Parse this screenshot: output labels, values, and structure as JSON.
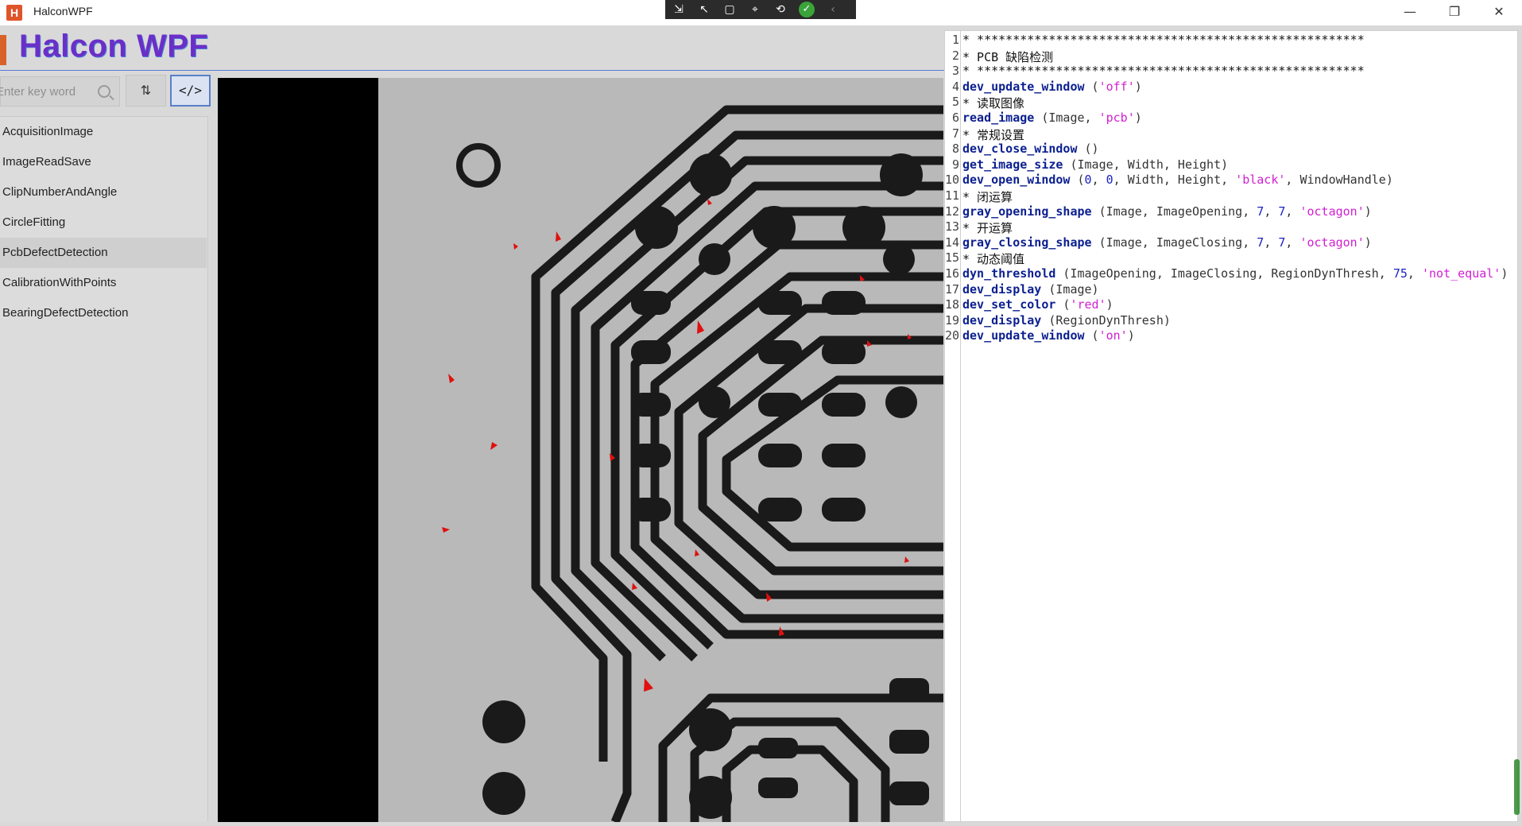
{
  "window": {
    "icon_letter": "H",
    "title": "HalconWPF",
    "minimize_glyph": "—",
    "restore_glyph": "❐",
    "close_glyph": "✕"
  },
  "debug_toolbar": {
    "icons": [
      "step-icon",
      "select-icon",
      "frame-icon",
      "inspect-icon",
      "hot-reload-icon",
      "check-icon",
      "collapse-icon"
    ],
    "glyphs": [
      "⇲",
      "↖",
      "▢",
      "⌖",
      "⟲",
      "✓",
      "‹"
    ]
  },
  "header": {
    "title": "Halcon WPF"
  },
  "search": {
    "placeholder": "Enter key word"
  },
  "buttons": {
    "sort_glyph": "⇅",
    "code_glyph": "</>"
  },
  "nav": {
    "selected_index": 4,
    "items": [
      {
        "label": "AcquisitionImage"
      },
      {
        "label": "ImageReadSave"
      },
      {
        "label": "ClipNumberAndAngle"
      },
      {
        "label": "CircleFitting"
      },
      {
        "label": "PcbDefectDetection"
      },
      {
        "label": "CalibrationWithPoints"
      },
      {
        "label": "BearingDefectDetection"
      }
    ]
  },
  "viewer": {
    "image": "pcb",
    "overlay_color": "#e01010"
  },
  "code": {
    "lines": [
      [
        {
          "t": "* ******************************************************",
          "c": "cmt"
        }
      ],
      [
        {
          "t": "* PCB 缺陷检测",
          "c": "cmt"
        }
      ],
      [
        {
          "t": "* ******************************************************",
          "c": "cmt"
        }
      ],
      [
        {
          "t": "dev_update_window",
          "c": "kw"
        },
        {
          "t": " (",
          "c": ""
        },
        {
          "t": "'off'",
          "c": "str"
        },
        {
          "t": ")",
          "c": ""
        }
      ],
      [
        {
          "t": "* 读取图像",
          "c": "cmt"
        }
      ],
      [
        {
          "t": "read_image",
          "c": "kw"
        },
        {
          "t": " (Image, ",
          "c": ""
        },
        {
          "t": "'pcb'",
          "c": "str"
        },
        {
          "t": ")",
          "c": ""
        }
      ],
      [
        {
          "t": "* 常规设置",
          "c": "cmt"
        }
      ],
      [
        {
          "t": "dev_close_window",
          "c": "kw"
        },
        {
          "t": " ()",
          "c": ""
        }
      ],
      [
        {
          "t": "get_image_size",
          "c": "kw"
        },
        {
          "t": " (Image, Width, Height)",
          "c": ""
        }
      ],
      [
        {
          "t": "dev_open_window",
          "c": "kw"
        },
        {
          "t": " (",
          "c": ""
        },
        {
          "t": "0",
          "c": "num"
        },
        {
          "t": ", ",
          "c": ""
        },
        {
          "t": "0",
          "c": "num"
        },
        {
          "t": ", Width, Height, ",
          "c": ""
        },
        {
          "t": "'black'",
          "c": "str"
        },
        {
          "t": ", WindowHandle)",
          "c": ""
        }
      ],
      [
        {
          "t": "* 闭运算",
          "c": "cmt"
        }
      ],
      [
        {
          "t": "gray_opening_shape",
          "c": "kw"
        },
        {
          "t": " (Image, ImageOpening, ",
          "c": ""
        },
        {
          "t": "7",
          "c": "num"
        },
        {
          "t": ", ",
          "c": ""
        },
        {
          "t": "7",
          "c": "num"
        },
        {
          "t": ", ",
          "c": ""
        },
        {
          "t": "'octagon'",
          "c": "str"
        },
        {
          "t": ")",
          "c": ""
        }
      ],
      [
        {
          "t": "* 开运算",
          "c": "cmt"
        }
      ],
      [
        {
          "t": "gray_closing_shape",
          "c": "kw"
        },
        {
          "t": " (Image, ImageClosing, ",
          "c": ""
        },
        {
          "t": "7",
          "c": "num"
        },
        {
          "t": ", ",
          "c": ""
        },
        {
          "t": "7",
          "c": "num"
        },
        {
          "t": ", ",
          "c": ""
        },
        {
          "t": "'octagon'",
          "c": "str"
        },
        {
          "t": ")",
          "c": ""
        }
      ],
      [
        {
          "t": "* 动态阈值",
          "c": "cmt"
        }
      ],
      [
        {
          "t": "dyn_threshold",
          "c": "kw"
        },
        {
          "t": " (ImageOpening, ImageClosing, RegionDynThresh, ",
          "c": ""
        },
        {
          "t": "75",
          "c": "num"
        },
        {
          "t": ", ",
          "c": ""
        },
        {
          "t": "'not_equal'",
          "c": "str"
        },
        {
          "t": ")",
          "c": ""
        }
      ],
      [
        {
          "t": "dev_display",
          "c": "kw"
        },
        {
          "t": " (Image)",
          "c": ""
        }
      ],
      [
        {
          "t": "dev_set_color",
          "c": "kw"
        },
        {
          "t": " (",
          "c": ""
        },
        {
          "t": "'red'",
          "c": "str"
        },
        {
          "t": ")",
          "c": ""
        }
      ],
      [
        {
          "t": "dev_display",
          "c": "kw"
        },
        {
          "t": " (RegionDynThresh)",
          "c": ""
        }
      ],
      [
        {
          "t": "dev_update_window",
          "c": "kw"
        },
        {
          "t": " (",
          "c": ""
        },
        {
          "t": "'on'",
          "c": "str"
        },
        {
          "t": ")",
          "c": ""
        }
      ]
    ]
  }
}
